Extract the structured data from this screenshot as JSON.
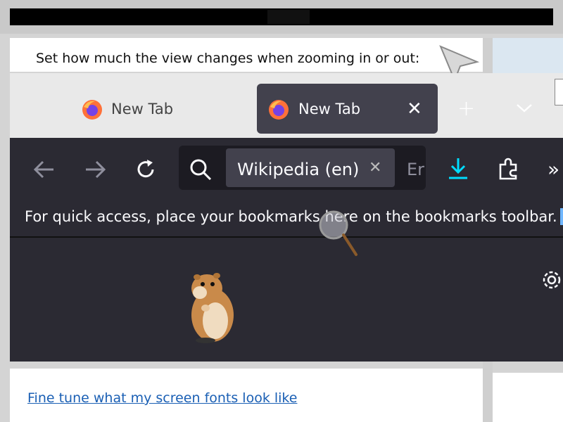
{
  "settings": {
    "zoom_description": "Set how much the view changes when zooming in or out:",
    "fonts_link": "Fine tune what my screen fonts look like"
  },
  "browser": {
    "tabs": [
      {
        "label": "New Tab",
        "active": false
      },
      {
        "label": "New Tab",
        "active": true
      }
    ],
    "close_glyph": "✕",
    "new_tab_glyph": "+",
    "search_engine_chip": "Wikipedia (en)",
    "chip_clear_glyph": "✕",
    "url_text": "Er",
    "overflow_glyph": "»",
    "bookmarks_hint": "For quick access, place your bookmarks here on the bookmarks toolbar.",
    "colors": {
      "toolbar_bg": "#2b2a33",
      "active_tab_bg": "#42414d",
      "download_accent": "#00ddff",
      "link": "#1a5fb4"
    }
  },
  "icons": [
    "cursor-arrow-icon",
    "firefox-icon",
    "chevron-down-icon",
    "back-arrow-icon",
    "forward-arrow-icon",
    "reload-icon",
    "search-icon",
    "download-icon",
    "puzzle-icon",
    "gear-icon",
    "magnifier-icon",
    "hamster-image"
  ]
}
